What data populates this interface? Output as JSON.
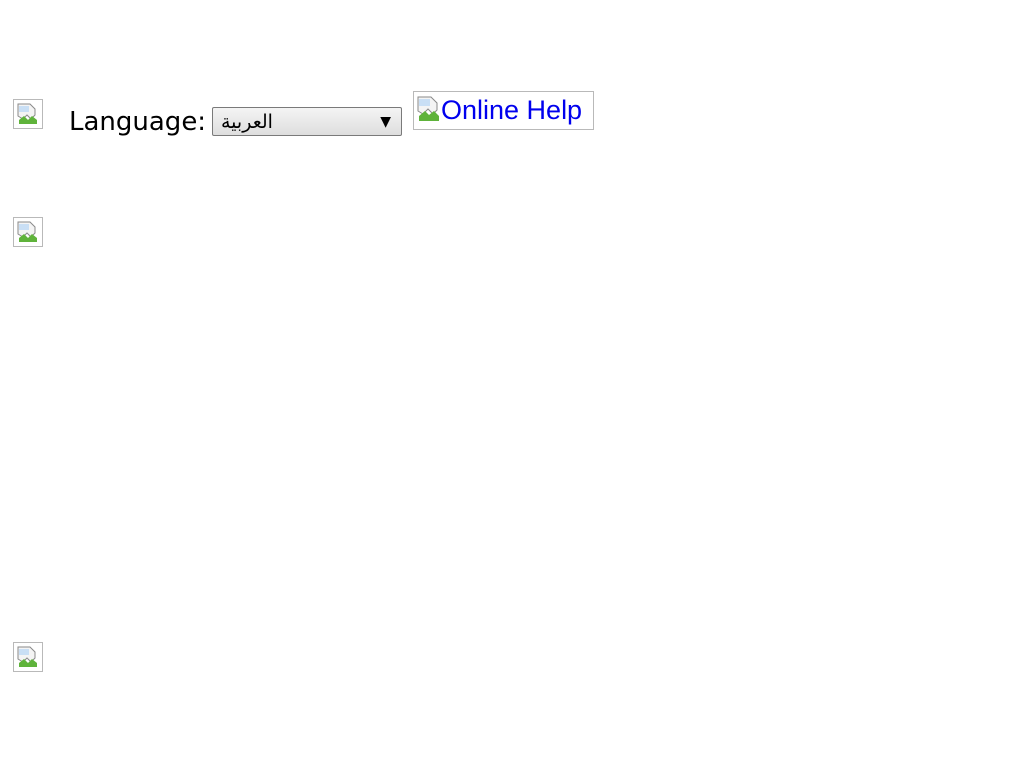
{
  "images": {
    "top_left": "broken-image-icon",
    "middle_left": "broken-image-icon",
    "bottom_left": "broken-image-icon"
  },
  "language": {
    "label": "Language:",
    "selected": "العربية"
  },
  "help": {
    "alt_text": "Online Help",
    "icon": "broken-image-icon"
  },
  "colors": {
    "link": "#0000ee",
    "image_border": "#b9b9b9"
  }
}
